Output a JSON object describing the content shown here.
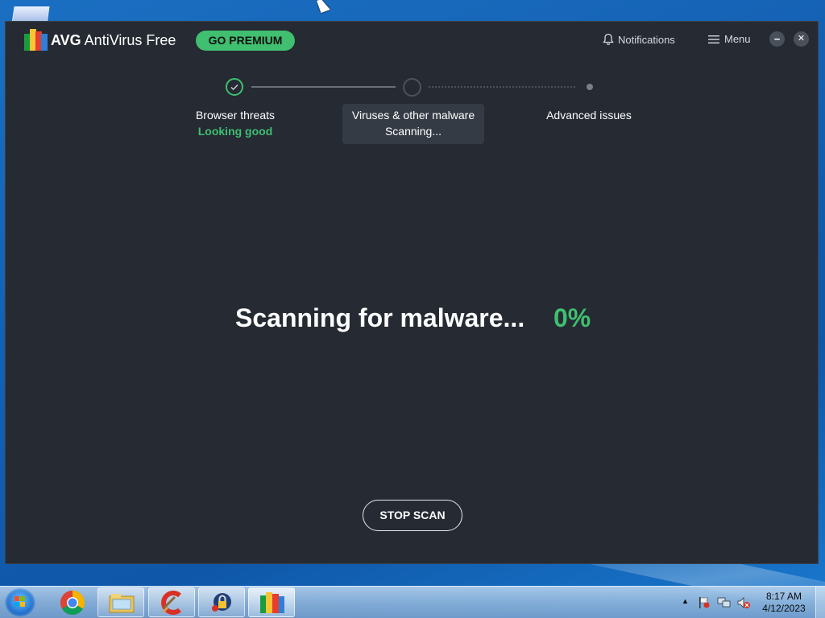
{
  "app": {
    "brand_bold": "AVG",
    "brand_rest": " AntiVirus Free",
    "go_premium": "GO PREMIUM",
    "notifications": "Notifications",
    "menu": "Menu",
    "minimize_glyph": "−",
    "close_glyph": "✕"
  },
  "steps": [
    {
      "label": "Browser threats",
      "status": "Looking good",
      "state": "done"
    },
    {
      "label": "Viruses & other malware",
      "status": "Scanning...",
      "state": "active"
    },
    {
      "label": "Advanced issues",
      "status": "",
      "state": "pending"
    }
  ],
  "scan": {
    "message": "Scanning for malware...",
    "percent": "0%",
    "stop_button": "STOP SCAN"
  },
  "taskbar": {
    "apps": [
      "chrome-icon",
      "file-explorer-icon",
      "ccleaner-icon",
      "security-app-icon",
      "avg-icon"
    ],
    "time": "8:17 AM",
    "date": "4/12/2023"
  },
  "colors": {
    "window_bg": "#252a33",
    "accent_green": "#3fbf6f",
    "active_step_bg": "#353b45"
  }
}
